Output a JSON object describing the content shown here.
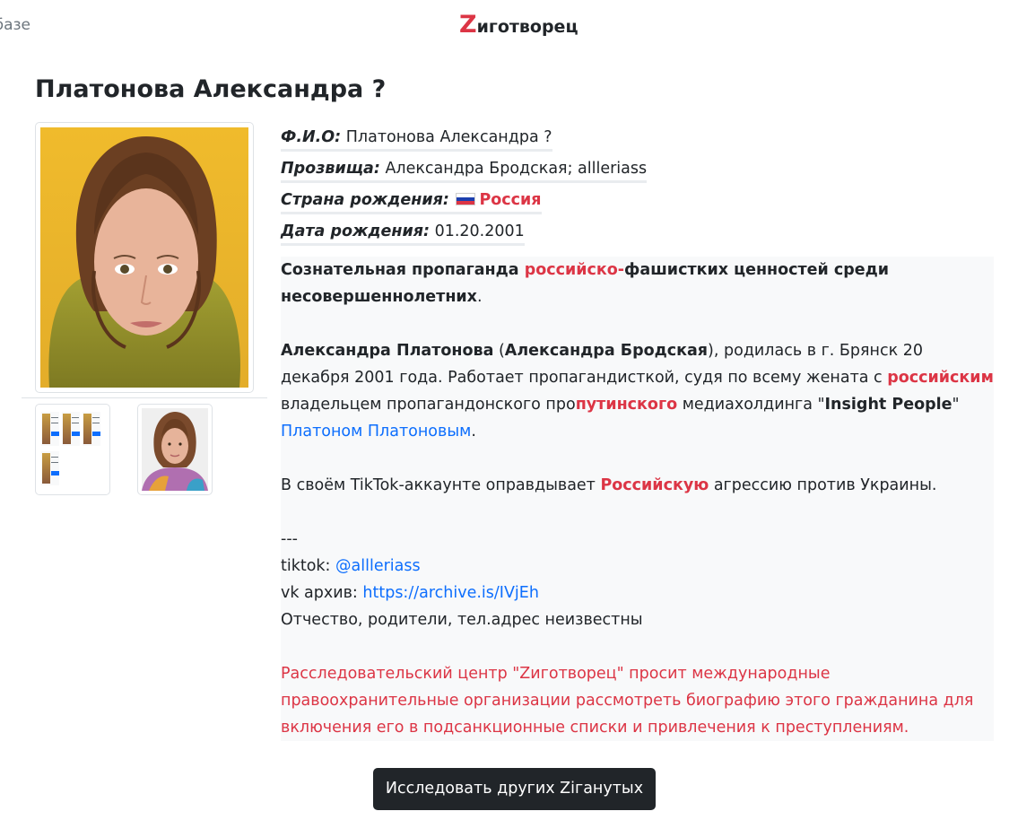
{
  "header": {
    "back_link": "К базе",
    "brand_initial": "Z",
    "brand_rest": "иготворец"
  },
  "profile": {
    "title": "Платонова Александра ?",
    "fields": {
      "fio_label": "Ф.И.О:",
      "fio_value": "Платонова Александра ?",
      "nickname_label": "Прозвища:",
      "nickname_value": "Александра Бродская; allleriass",
      "country_label": "Страна рождения:",
      "country_value": "Россия",
      "birthdate_label": "Дата рождения:",
      "birthdate_value": "01.20.2001"
    },
    "bio": {
      "p1_a": "Сознательная пропаганда ",
      "p1_red": "российско-",
      "p1_b": "фашистких ценностей среди несовершеннолетних",
      "p1_dot": ".",
      "p2_name": "Александра Платонова",
      "p2_open": " (",
      "p2_alias": "Александра Бродская",
      "p2_text1": "), родилась в г. Брянск 20 декабря 2001 года. Работает пропагандисткой, судя по всему жената с ",
      "p2_red1": "российским",
      "p2_text2": " владельцем пропагандонского про",
      "p2_red2": "путинского",
      "p2_text3": " медиахолдинга \"",
      "p2_company": "Insight People",
      "p2_text4": "\" ",
      "p2_link": "Платоном Платоновым",
      "p2_end": ".",
      "p3_a": "В своём TikTok-аккаунте оправдывает ",
      "p3_red": "Российскую",
      "p3_b": " агрессию против Украины.",
      "separator": "---",
      "tiktok_label": "tiktok: ",
      "tiktok_link": "@allleriass",
      "vk_label": "vk архив: ",
      "vk_link": "https://archive.is/IVjEh",
      "unknown": "Отчество, родители, тел.адрес неизвестны",
      "notice": "Расследовательский центр \"Zиготворец\" просит международные правоохранительные организации рассмотреть биографию этого гражданина для включения его в подсанкционные списки и привлечения к преступлениям."
    }
  },
  "actions": {
    "explore_button": "Исследовать других Ziганутых"
  },
  "icons": {
    "flag": "russia-flag-icon"
  },
  "colors": {
    "accent_red": "#dc3545",
    "link_blue": "#0d6efd",
    "button_dark": "#212529",
    "panel_bg": "#f8f9fa"
  }
}
